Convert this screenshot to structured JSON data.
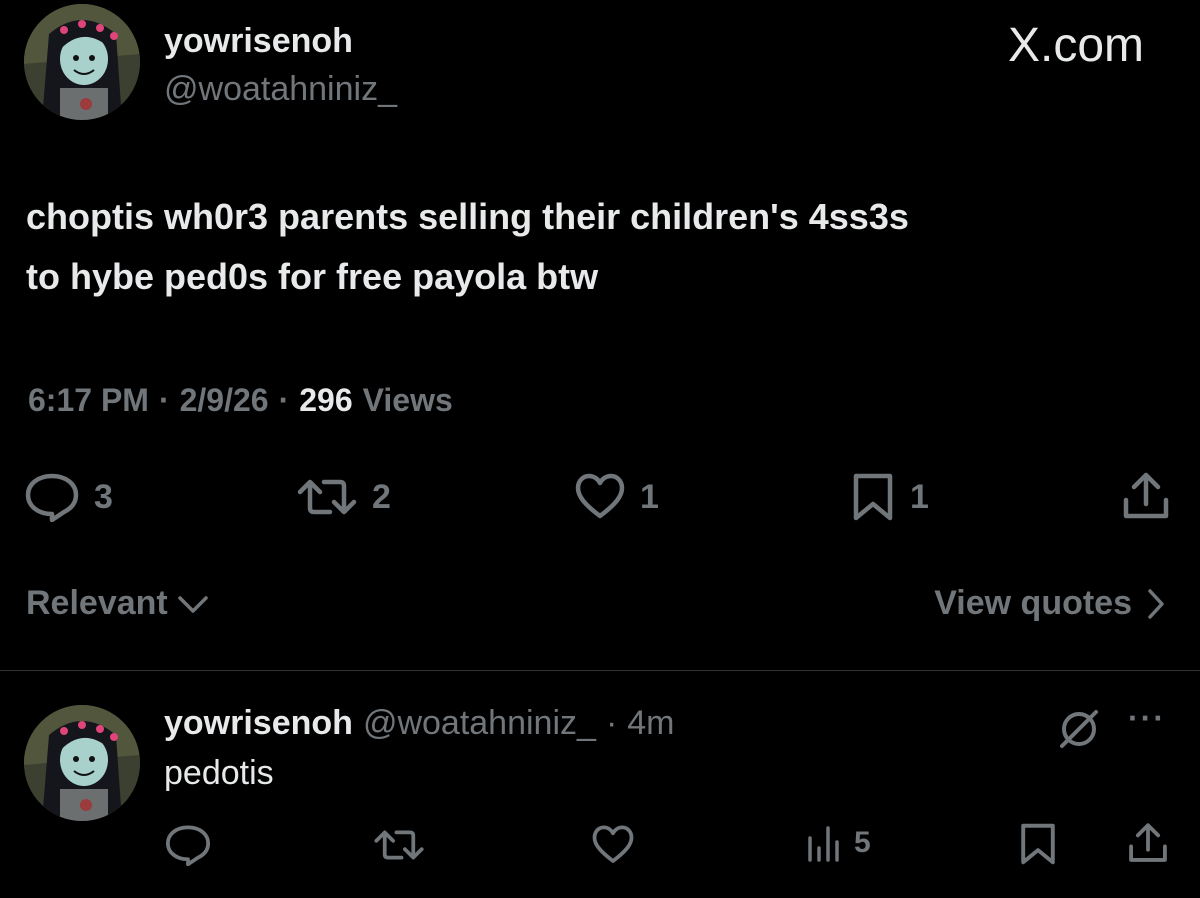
{
  "header": {
    "brand": "X.com",
    "display_name": "yowrisenoh",
    "handle": "@woatahniniz_"
  },
  "tweet": {
    "text_line1": "choptis wh0r3 parents selling their children's 4ss3s",
    "text_line2": "to hybe ped0s for free payola btw",
    "time": "6:17 PM",
    "sep1": "·",
    "date": "2/9/26",
    "sep2": "·",
    "views_count": "296",
    "views_label": "Views",
    "replies": "3",
    "reposts": "2",
    "likes": "1",
    "bookmarks": "1"
  },
  "sort": {
    "label": "Relevant"
  },
  "quotes": {
    "label": "View quotes"
  },
  "reply": {
    "display_name": "yowrisenoh",
    "handle": "@woatahniniz_",
    "dot": "·",
    "age": "4m",
    "text": "pedotis",
    "views": "5",
    "more": "···"
  },
  "colors": {
    "background": "#000000",
    "text": "#e7e9ea",
    "muted": "#71767b",
    "divider": "#2f3336"
  }
}
